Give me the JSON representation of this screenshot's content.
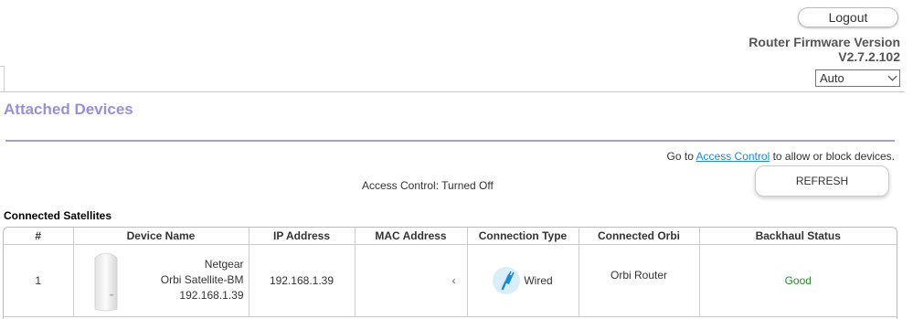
{
  "header": {
    "logout_label": "Logout",
    "firmware_title": "Router Firmware Version",
    "firmware_version": "V2.7.2.102",
    "language_selected": "Auto"
  },
  "page": {
    "title": "Attached Devices",
    "goto_prefix": "Go to",
    "goto_link": "Access Control",
    "goto_suffix": "to allow or block devices.",
    "access_control_status": "Access Control: Turned Off",
    "refresh_label": "REFRESH",
    "section_title": "Connected Satellites"
  },
  "table": {
    "columns": [
      "#",
      "Device Name",
      "IP Address",
      "MAC Address",
      "Connection Type",
      "Connected Orbi",
      "Backhaul Status"
    ],
    "rows": [
      {
        "index": "1",
        "device_brand": "Netgear",
        "device_model": "Orbi Satellite-BM",
        "device_ip_line": "192.168.1.39",
        "ip": "192.168.1.39",
        "mac": "",
        "connection_type": "Wired",
        "connected_orbi": "Orbi Router",
        "backhaul_status": "Good"
      }
    ]
  },
  "colors": {
    "title_purple": "#9b8fd8",
    "link_blue": "#1a8ad4",
    "good_green": "#2a8a2a",
    "icon_bg": "#d9eef9"
  },
  "icons": {
    "connection": "wired-plug-icon",
    "device": "orbi-satellite-device-icon"
  }
}
